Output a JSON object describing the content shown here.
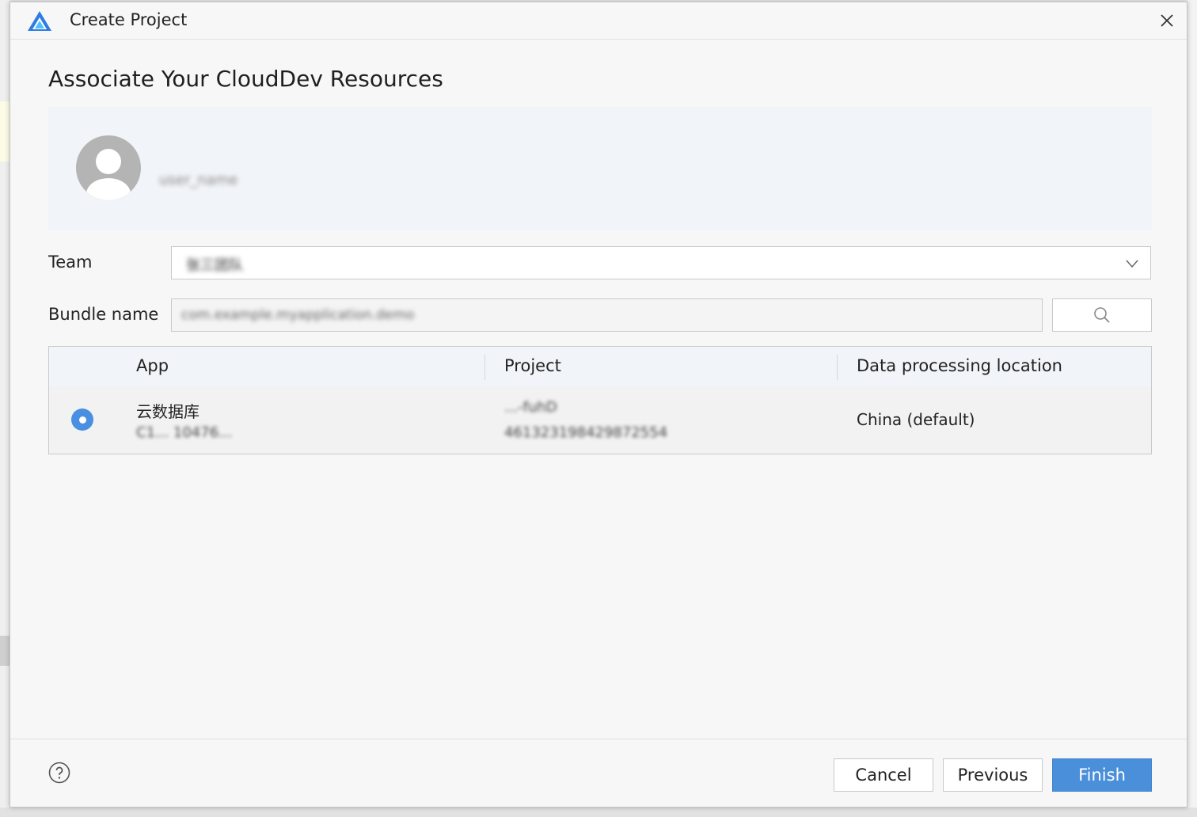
{
  "window": {
    "title": "Create Project",
    "close_icon": "close-icon",
    "logo_icon": "app-logo-icon"
  },
  "page": {
    "heading": "Associate Your CloudDev Resources"
  },
  "profile": {
    "avatar_icon": "user-avatar-icon",
    "username": "user_name"
  },
  "form": {
    "team_label": "Team",
    "team_value": "张三团队",
    "bundle_label": "Bundle name",
    "bundle_value": "com.example.myapplication.demo",
    "search_icon": "search-icon"
  },
  "table": {
    "headers": {
      "app": "App",
      "project": "Project",
      "location": "Data processing location"
    },
    "rows": [
      {
        "selected": true,
        "app_name": "云数据库",
        "app_id": "C1... 10476...",
        "project_name": "...-fuhD",
        "project_id": "461323198429872554",
        "location": "China (default)"
      }
    ]
  },
  "footer": {
    "help_icon": "help-icon",
    "cancel_label": "Cancel",
    "previous_label": "Previous",
    "finish_label": "Finish"
  },
  "colors": {
    "primary": "#4a8fd9",
    "radio": "#4a90e2",
    "panel": "#f1f4f8"
  }
}
